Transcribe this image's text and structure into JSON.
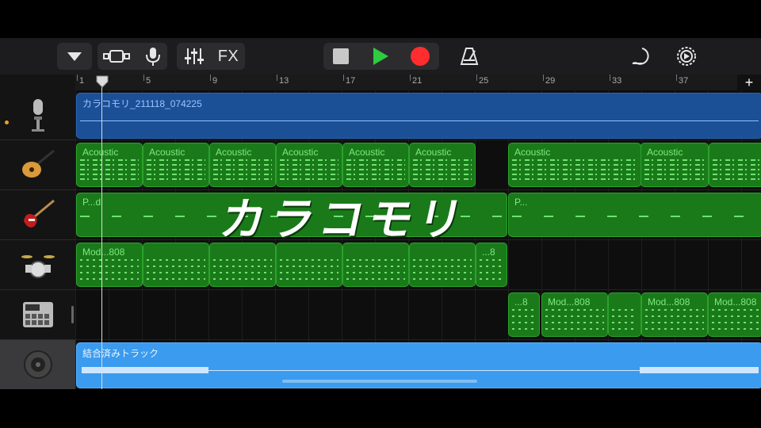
{
  "toolbar": {
    "fx_label": "FX",
    "icons": [
      "chevron-down-icon",
      "tracks-view-icon",
      "microphone-icon",
      "mixer-icon",
      "stop-icon",
      "play-icon",
      "record-icon",
      "metronome-icon",
      "loop-browser-icon",
      "settings-icon"
    ],
    "colors": {
      "play": "#2ecc40",
      "record": "#ff2d2d",
      "stop": "#c8c8c8"
    }
  },
  "ruler": {
    "markers": [
      "1",
      "5",
      "9",
      "13",
      "17",
      "21",
      "25",
      "29",
      "33",
      "37"
    ],
    "add_label": "+"
  },
  "tracks": [
    {
      "icon": "microphone-track-icon",
      "regions": [
        {
          "label": "カラコモリ_211118_074225",
          "color": "dark-blue"
        }
      ]
    },
    {
      "icon": "acoustic-guitar-icon",
      "regions": [
        {
          "label": "Acoustic"
        },
        {
          "label": "Acoustic"
        },
        {
          "label": "Acoustic"
        },
        {
          "label": "Acoustic"
        },
        {
          "label": "Acoustic"
        },
        {
          "label": "Acoustic"
        },
        {
          "label": "Acoustic"
        },
        {
          "label": "Acoustic"
        },
        {
          "label": ""
        }
      ]
    },
    {
      "icon": "electric-guitar-icon",
      "regions": [
        {
          "label": "P...d"
        },
        {
          "label": "P..."
        }
      ]
    },
    {
      "icon": "drum-kit-icon",
      "regions": [
        {
          "label": "Mod...808"
        },
        {
          "label": ""
        },
        {
          "label": ""
        },
        {
          "label": ""
        },
        {
          "label": ""
        },
        {
          "label": ""
        },
        {
          "label": "...8"
        }
      ]
    },
    {
      "icon": "beat-sequencer-icon",
      "regions": [
        {
          "label": "...8"
        },
        {
          "label": "Mod...808"
        },
        {
          "label": ""
        },
        {
          "label": "Mod...808"
        },
        {
          "label": "Mod...808"
        }
      ]
    },
    {
      "icon": "speaker-icon",
      "regions": [
        {
          "label": "結合済みトラック",
          "color": "light-blue"
        }
      ]
    }
  ],
  "overlay_text": "カラコモリ"
}
